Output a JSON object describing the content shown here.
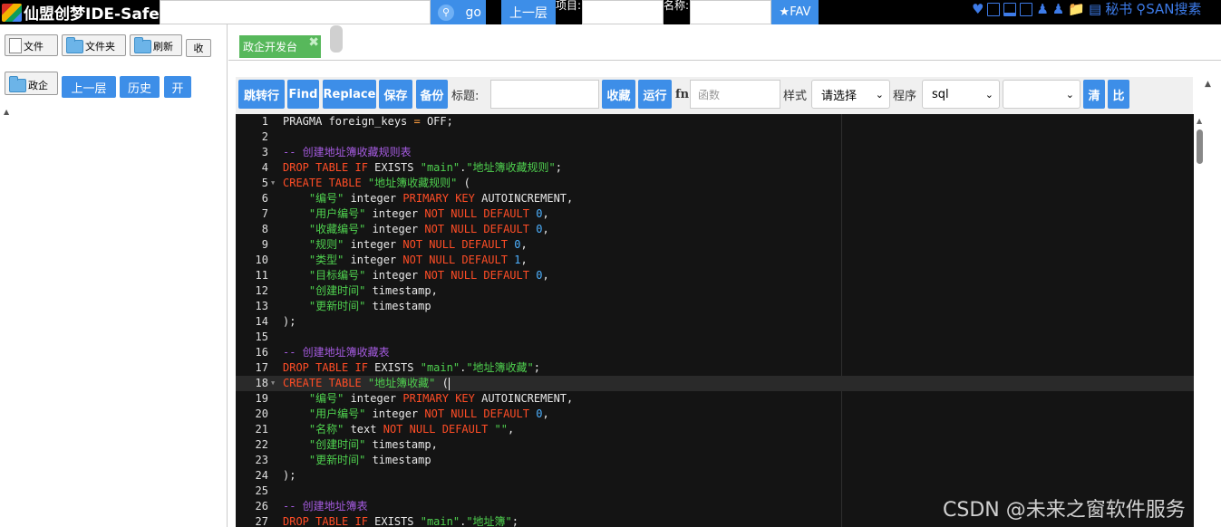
{
  "topbar": {
    "app_title": "仙盟创梦IDE-Safe",
    "go_label": "go",
    "up_label": "上一层",
    "project_label": "项目:",
    "name_label": "名称:",
    "fav_label": "★FAV",
    "heart": "♥",
    "secretary": "秘书",
    "search_label": "SAN搜素"
  },
  "left": {
    "file_btn": "文件",
    "folder_btn": "文件夹",
    "refresh_btn": "刷新",
    "collect_btn": "收",
    "gov_btn": "政企",
    "up_btn": "上一层",
    "history_btn": "历史",
    "open_btn": "开"
  },
  "tabs": [
    {
      "label": "政企开发台"
    }
  ],
  "toolbar": {
    "goto_line": "跳转行",
    "find": "Find",
    "replace": "Replace",
    "save": "保存",
    "backup": "备份",
    "title_label": "标题:",
    "title_value": "",
    "collect": "收藏",
    "run": "运行",
    "fn_label": "fn",
    "fn_placeholder": "函数",
    "style_label": "样式",
    "style_value": "请选择",
    "program_label": "程序",
    "program_value": "sql",
    "extra_value": "",
    "clear": "清",
    "compare": "比"
  },
  "code": {
    "active_line": 18,
    "lines": [
      {
        "n": "1",
        "fold": false,
        "tokens": [
          [
            "id",
            "PRAGMA foreign_keys "
          ],
          [
            "op",
            "="
          ],
          [
            "id",
            " OFF;"
          ]
        ]
      },
      {
        "n": "2",
        "fold": false,
        "tokens": []
      },
      {
        "n": "3",
        "fold": false,
        "tokens": [
          [
            "com",
            "-- 创建地址簿收藏规则表"
          ]
        ]
      },
      {
        "n": "4",
        "fold": false,
        "tokens": [
          [
            "kw",
            "DROP TABLE IF "
          ],
          [
            "id",
            "EXISTS "
          ],
          [
            "str",
            "\"main\""
          ],
          [
            "id",
            "."
          ],
          [
            "str",
            "\"地址簿收藏规则\""
          ],
          [
            "id",
            ";"
          ]
        ]
      },
      {
        "n": "5",
        "fold": true,
        "tokens": [
          [
            "kw",
            "CREATE TABLE "
          ],
          [
            "str",
            "\"地址簿收藏规则\""
          ],
          [
            "id",
            " ("
          ]
        ]
      },
      {
        "n": "6",
        "fold": false,
        "tokens": [
          [
            "id",
            "    "
          ],
          [
            "str",
            "\"编号\""
          ],
          [
            "id",
            " integer "
          ],
          [
            "kw",
            "PRIMARY KEY "
          ],
          [
            "id",
            "AUTOINCREMENT,"
          ]
        ]
      },
      {
        "n": "7",
        "fold": false,
        "tokens": [
          [
            "id",
            "    "
          ],
          [
            "str",
            "\"用户编号\""
          ],
          [
            "id",
            " integer "
          ],
          [
            "kw",
            "NOT NULL DEFAULT "
          ],
          [
            "num",
            "0"
          ],
          [
            "id",
            ","
          ]
        ]
      },
      {
        "n": "8",
        "fold": false,
        "tokens": [
          [
            "id",
            "    "
          ],
          [
            "str",
            "\"收藏编号\""
          ],
          [
            "id",
            " integer "
          ],
          [
            "kw",
            "NOT NULL DEFAULT "
          ],
          [
            "num",
            "0"
          ],
          [
            "id",
            ","
          ]
        ]
      },
      {
        "n": "9",
        "fold": false,
        "tokens": [
          [
            "id",
            "    "
          ],
          [
            "str",
            "\"规则\""
          ],
          [
            "id",
            " integer "
          ],
          [
            "kw",
            "NOT NULL DEFAULT "
          ],
          [
            "num",
            "0"
          ],
          [
            "id",
            ","
          ]
        ]
      },
      {
        "n": "10",
        "fold": false,
        "tokens": [
          [
            "id",
            "    "
          ],
          [
            "str",
            "\"类型\""
          ],
          [
            "id",
            " integer "
          ],
          [
            "kw",
            "NOT NULL DEFAULT "
          ],
          [
            "num",
            "1"
          ],
          [
            "id",
            ","
          ]
        ]
      },
      {
        "n": "11",
        "fold": false,
        "tokens": [
          [
            "id",
            "    "
          ],
          [
            "str",
            "\"目标编号\""
          ],
          [
            "id",
            " integer "
          ],
          [
            "kw",
            "NOT NULL DEFAULT "
          ],
          [
            "num",
            "0"
          ],
          [
            "id",
            ","
          ]
        ]
      },
      {
        "n": "12",
        "fold": false,
        "tokens": [
          [
            "id",
            "    "
          ],
          [
            "str",
            "\"创建时间\""
          ],
          [
            "id",
            " timestamp,"
          ]
        ]
      },
      {
        "n": "13",
        "fold": false,
        "tokens": [
          [
            "id",
            "    "
          ],
          [
            "str",
            "\"更新时间\""
          ],
          [
            "id",
            " timestamp"
          ]
        ]
      },
      {
        "n": "14",
        "fold": false,
        "tokens": [
          [
            "id",
            ");"
          ]
        ]
      },
      {
        "n": "15",
        "fold": false,
        "tokens": []
      },
      {
        "n": "16",
        "fold": false,
        "tokens": [
          [
            "com",
            "-- 创建地址簿收藏表"
          ]
        ]
      },
      {
        "n": "17",
        "fold": false,
        "tokens": [
          [
            "kw",
            "DROP TABLE IF "
          ],
          [
            "id",
            "EXISTS "
          ],
          [
            "str",
            "\"main\""
          ],
          [
            "id",
            "."
          ],
          [
            "str",
            "\"地址簿收藏\""
          ],
          [
            "id",
            ";"
          ]
        ]
      },
      {
        "n": "18",
        "fold": true,
        "tokens": [
          [
            "kw",
            "CREATE TABLE "
          ],
          [
            "str",
            "\"地址簿收藏\""
          ],
          [
            "id",
            " ("
          ]
        ]
      },
      {
        "n": "19",
        "fold": false,
        "tokens": [
          [
            "id",
            "    "
          ],
          [
            "str",
            "\"编号\""
          ],
          [
            "id",
            " integer "
          ],
          [
            "kw",
            "PRIMARY KEY "
          ],
          [
            "id",
            "AUTOINCREMENT,"
          ]
        ]
      },
      {
        "n": "20",
        "fold": false,
        "tokens": [
          [
            "id",
            "    "
          ],
          [
            "str",
            "\"用户编号\""
          ],
          [
            "id",
            " integer "
          ],
          [
            "kw",
            "NOT NULL DEFAULT "
          ],
          [
            "num",
            "0"
          ],
          [
            "id",
            ","
          ]
        ]
      },
      {
        "n": "21",
        "fold": false,
        "tokens": [
          [
            "id",
            "    "
          ],
          [
            "str",
            "\"名称\""
          ],
          [
            "id",
            " text "
          ],
          [
            "kw",
            "NOT NULL DEFAULT "
          ],
          [
            "str",
            "\"\""
          ],
          [
            "id",
            ","
          ]
        ]
      },
      {
        "n": "22",
        "fold": false,
        "tokens": [
          [
            "id",
            "    "
          ],
          [
            "str",
            "\"创建时间\""
          ],
          [
            "id",
            " timestamp,"
          ]
        ]
      },
      {
        "n": "23",
        "fold": false,
        "tokens": [
          [
            "id",
            "    "
          ],
          [
            "str",
            "\"更新时间\""
          ],
          [
            "id",
            " timestamp"
          ]
        ]
      },
      {
        "n": "24",
        "fold": false,
        "tokens": [
          [
            "id",
            ");"
          ]
        ]
      },
      {
        "n": "25",
        "fold": false,
        "tokens": []
      },
      {
        "n": "26",
        "fold": false,
        "tokens": [
          [
            "com",
            "-- 创建地址簿表"
          ]
        ]
      },
      {
        "n": "27",
        "fold": false,
        "tokens": [
          [
            "kw",
            "DROP TABLE IF "
          ],
          [
            "id",
            "EXISTS "
          ],
          [
            "str",
            "\"main\""
          ],
          [
            "id",
            "."
          ],
          [
            "str",
            "\"地址簿\""
          ],
          [
            "id",
            ";"
          ]
        ]
      }
    ]
  },
  "watermark": "CSDN @未来之窗软件服务",
  "colors": {
    "accent": "#3d8ee8",
    "tab_green": "#57b85b",
    "editor_bg": "#141414",
    "keyword": "#ff4d26",
    "string": "#4fd14f",
    "comment": "#a55be0",
    "number": "#4db1ff"
  }
}
